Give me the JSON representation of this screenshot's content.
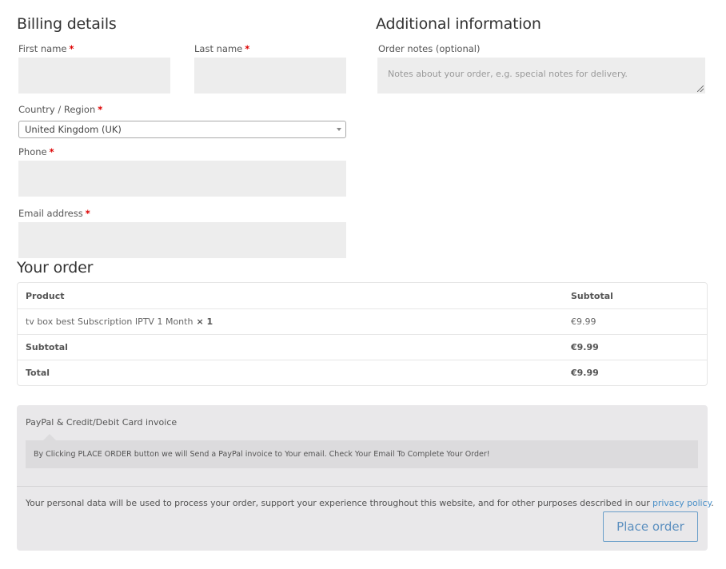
{
  "billing": {
    "title": "Billing details",
    "first_name_label": "First name",
    "last_name_label": "Last name",
    "country_label": "Country / Region",
    "country_value": "United Kingdom (UK)",
    "phone_label": "Phone",
    "email_label": "Email address",
    "required_marker": "*",
    "first_name_value": "",
    "last_name_value": "",
    "phone_value": "",
    "email_value": ""
  },
  "additional": {
    "title": "Additional information",
    "notes_label": "Order notes (optional)",
    "notes_placeholder": "Notes about your order, e.g. special notes for delivery."
  },
  "order": {
    "title": "Your order",
    "headers": {
      "product": "Product",
      "subtotal": "Subtotal"
    },
    "items": [
      {
        "name": "tv box best Subscription IPTV 1 Month",
        "qty": "× 1",
        "price": "€9.99"
      }
    ],
    "subtotal_label": "Subtotal",
    "subtotal_value": "€9.99",
    "total_label": "Total",
    "total_value": "€9.99"
  },
  "payment": {
    "method_label": "PayPal & Credit/Debit Card invoice",
    "method_description": "By Clicking PLACE ORDER button we will Send a PayPal invoice to Your email. Check Your Email To Complete Your Order!",
    "privacy_text": "Your personal data will be used to process your order, support your experience throughout this website, and for other purposes described in our ",
    "privacy_link": "privacy policy",
    "privacy_end": ".",
    "place_order_label": "Place order"
  }
}
